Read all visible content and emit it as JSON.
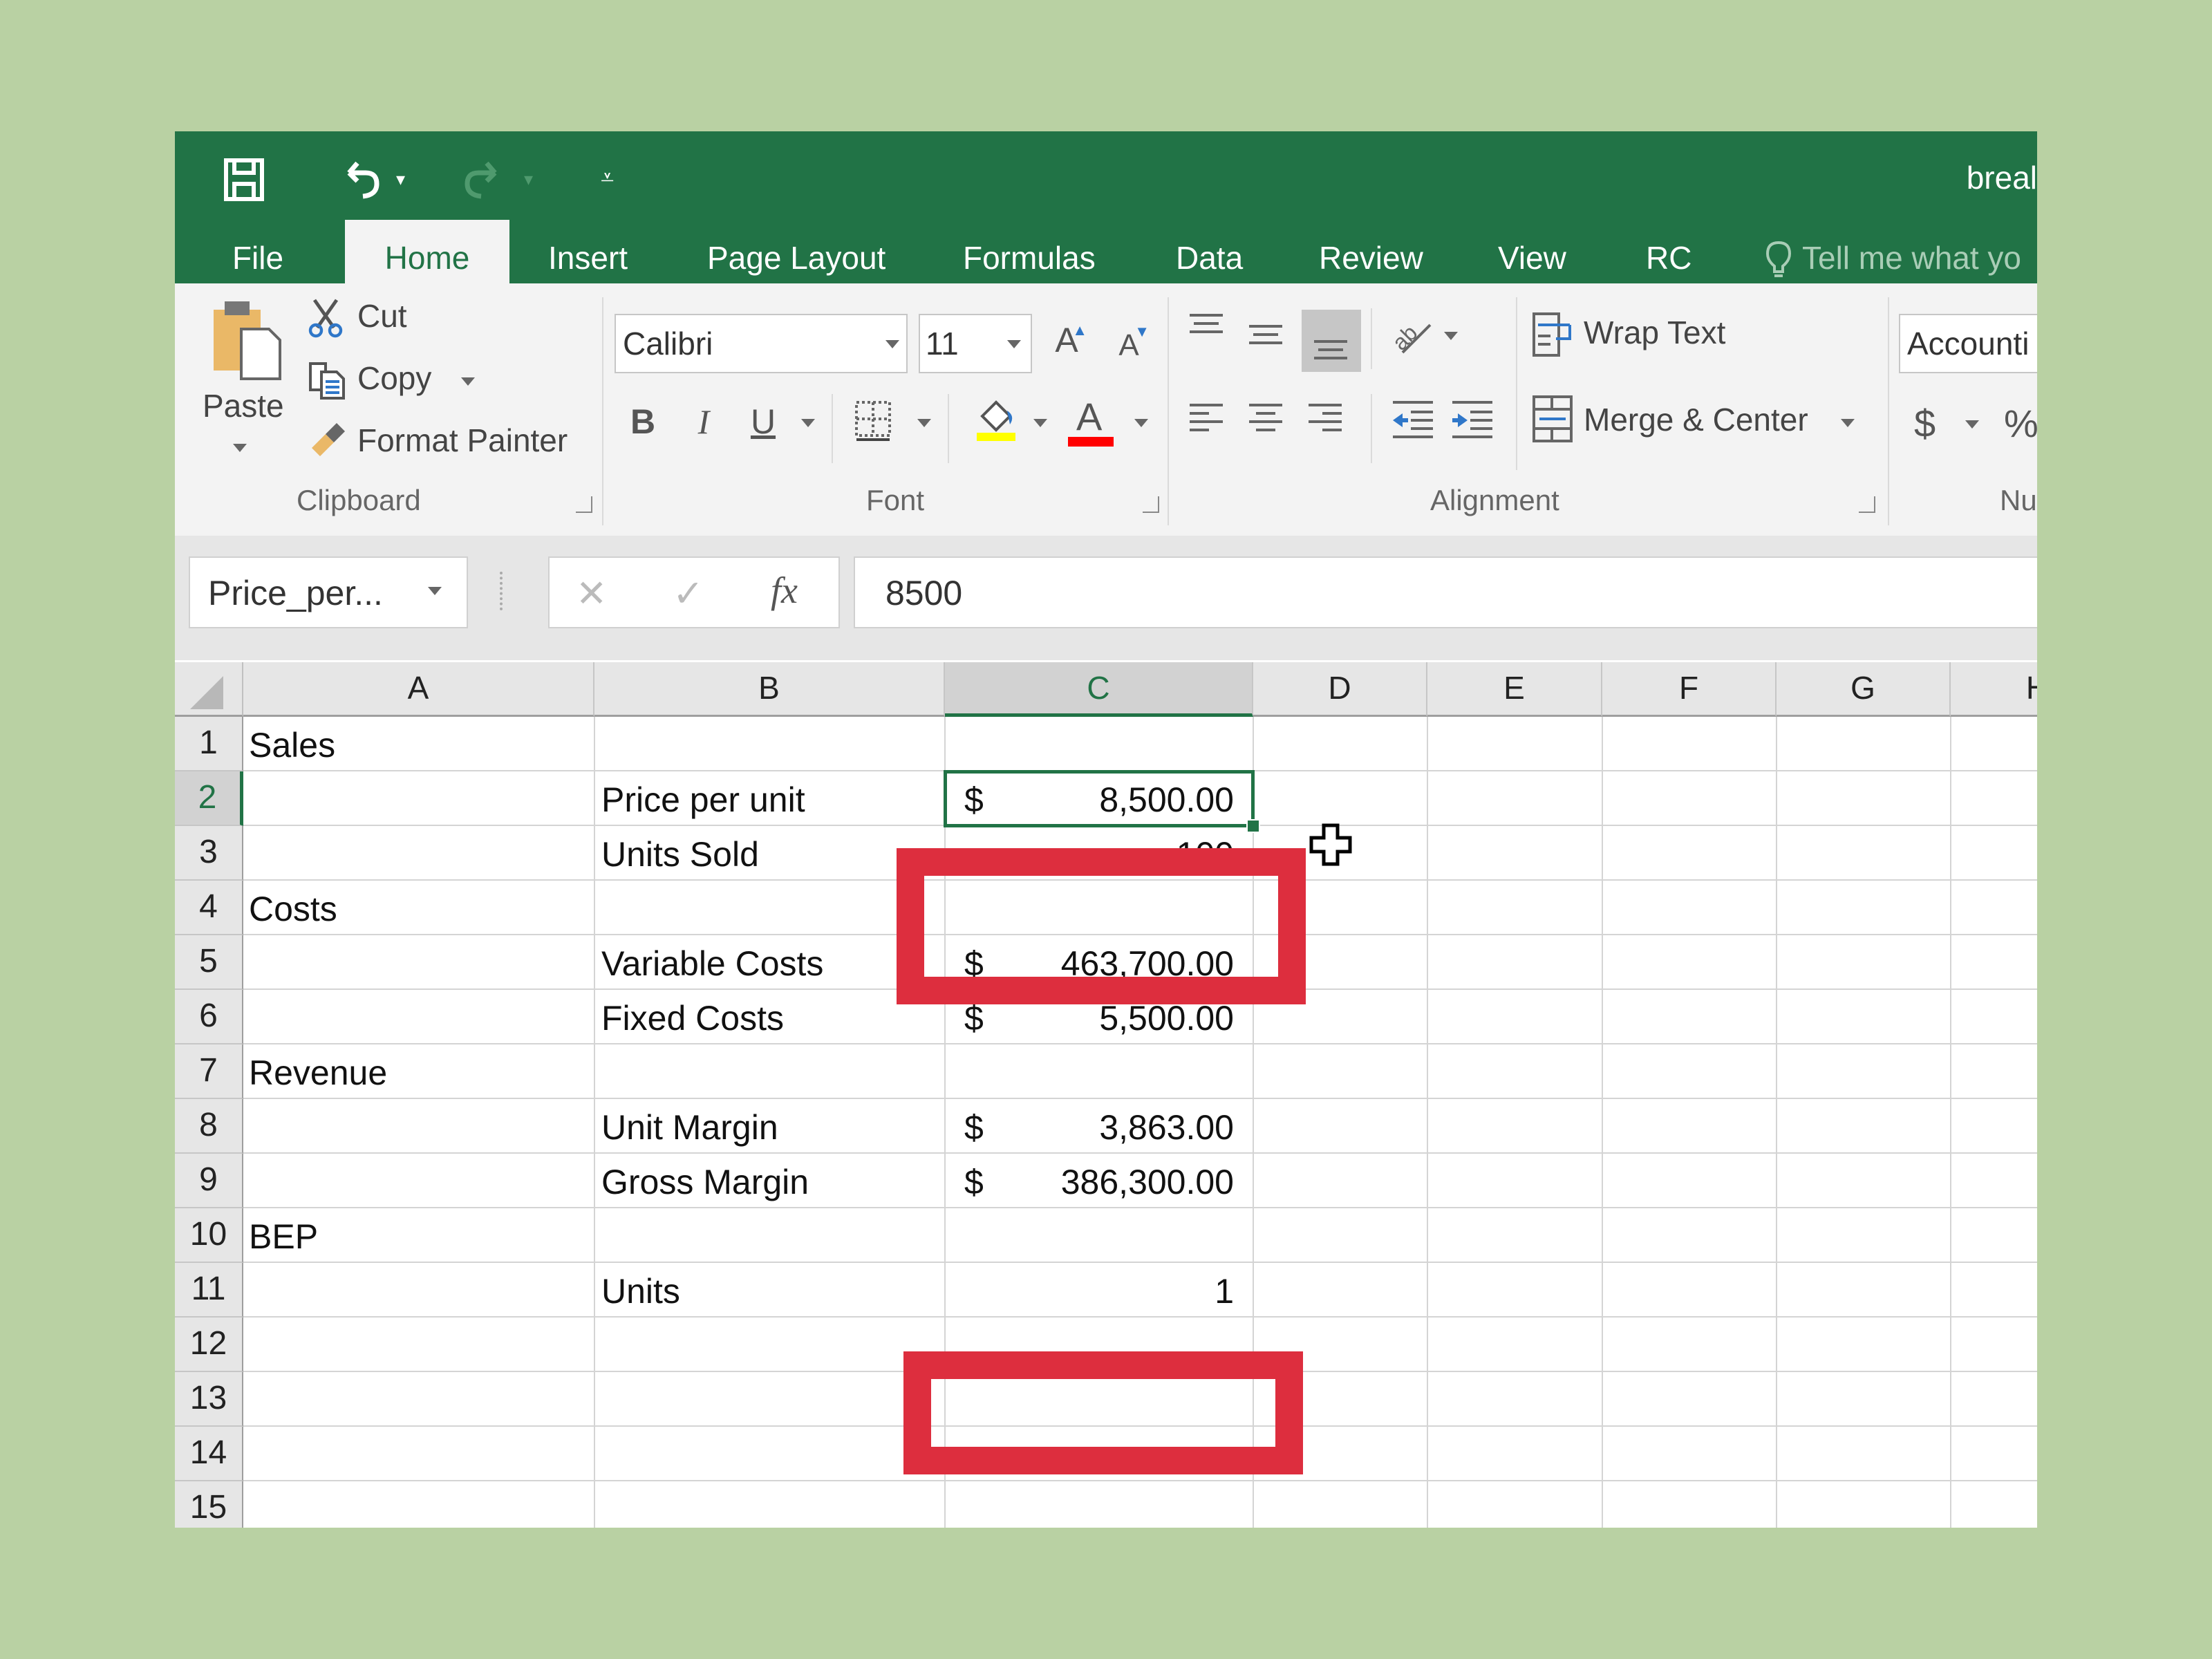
{
  "window": {
    "title_partial": "breal",
    "qat": {
      "save_icon": "save-icon",
      "undo_icon": "undo-icon",
      "redo_icon": "redo-icon",
      "customize_icon": "customize-qat-icon"
    }
  },
  "tabs": [
    {
      "label": "File",
      "active": false
    },
    {
      "label": "Home",
      "active": true
    },
    {
      "label": "Insert",
      "active": false
    },
    {
      "label": "Page Layout",
      "active": false
    },
    {
      "label": "Formulas",
      "active": false
    },
    {
      "label": "Data",
      "active": false
    },
    {
      "label": "Review",
      "active": false
    },
    {
      "label": "View",
      "active": false
    },
    {
      "label": "RC",
      "active": false
    }
  ],
  "tell_me": {
    "icon": "lightbulb-icon",
    "placeholder": "Tell me what yo"
  },
  "ribbon": {
    "clipboard": {
      "group_label": "Clipboard",
      "paste": "Paste",
      "cut": "Cut",
      "copy": "Copy",
      "format_painter": "Format Painter"
    },
    "font": {
      "group_label": "Font",
      "font_name": "Calibri",
      "font_size": "11",
      "grow_icon": "A",
      "shrink_icon": "A",
      "bold": "B",
      "italic": "I",
      "underline": "U",
      "fill_color": "#ffff00",
      "font_color": "#ff0000",
      "font_color_glyph": "A"
    },
    "alignment": {
      "group_label": "Alignment",
      "wrap_text": "Wrap Text",
      "merge_center": "Merge & Center"
    },
    "number": {
      "group_label_partial": "Nu",
      "format": "Accounti",
      "currency": "$",
      "percent": "%"
    }
  },
  "formula_bar": {
    "name_box": "Price_per...",
    "cancel_glyph": "✕",
    "enter_glyph": "✓",
    "fx_glyph": "fx",
    "value": "8500"
  },
  "sheet": {
    "columns": [
      "A",
      "B",
      "C",
      "D",
      "E",
      "F",
      "G",
      "H"
    ],
    "selected_column": "C",
    "selected_row": 2,
    "selected_cell": "C2",
    "rows": [
      {
        "num": "1",
        "A": "Sales",
        "B": "",
        "C_sym": "",
        "C_val": ""
      },
      {
        "num": "2",
        "A": "",
        "B": "Price per unit",
        "C_sym": "$",
        "C_val": "8,500.00"
      },
      {
        "num": "3",
        "A": "",
        "B": "Units Sold",
        "C_sym": "",
        "C_val": "100"
      },
      {
        "num": "4",
        "A": "Costs",
        "B": "",
        "C_sym": "",
        "C_val": ""
      },
      {
        "num": "5",
        "A": "",
        "B": "Variable Costs",
        "C_sym": "$",
        "C_val": "463,700.00"
      },
      {
        "num": "6",
        "A": "",
        "B": "Fixed Costs",
        "C_sym": "$",
        "C_val": "5,500.00"
      },
      {
        "num": "7",
        "A": "Revenue",
        "B": "",
        "C_sym": "",
        "C_val": ""
      },
      {
        "num": "8",
        "A": "",
        "B": "Unit Margin",
        "C_sym": "$",
        "C_val": "3,863.00"
      },
      {
        "num": "9",
        "A": "",
        "B": "Gross Margin",
        "C_sym": "$",
        "C_val": "386,300.00"
      },
      {
        "num": "10",
        "A": "BEP",
        "B": "",
        "C_sym": "",
        "C_val": ""
      },
      {
        "num": "11",
        "A": "",
        "B": "Units",
        "C_sym": "",
        "C_val": "1"
      },
      {
        "num": "12",
        "A": "",
        "B": "",
        "C_sym": "",
        "C_val": ""
      },
      {
        "num": "13",
        "A": "",
        "B": "",
        "C_sym": "",
        "C_val": ""
      },
      {
        "num": "14",
        "A": "",
        "B": "",
        "C_sym": "",
        "C_val": ""
      },
      {
        "num": "15",
        "A": "",
        "B": "",
        "C_sym": "",
        "C_val": ""
      }
    ]
  },
  "annotations": {
    "highlight_color": "#dd2e3e",
    "highlights": [
      "C2",
      "C11"
    ]
  },
  "colors": {
    "excel_green": "#217346",
    "background": "#b9d1a3"
  }
}
